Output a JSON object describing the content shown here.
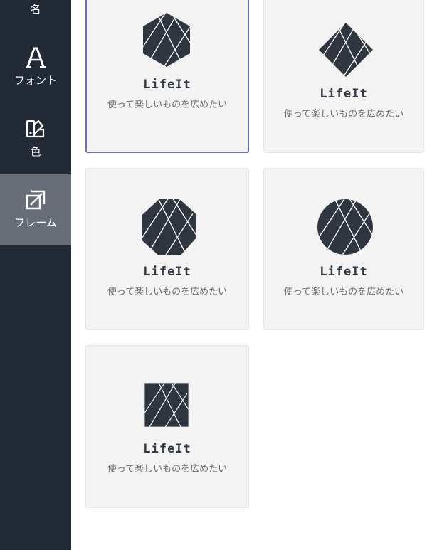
{
  "sidebar": {
    "items": [
      {
        "label": "名",
        "icon": "tag-icon"
      },
      {
        "label": "フォント",
        "icon": "font-icon"
      },
      {
        "label": "色",
        "icon": "paint-palette-icon"
      },
      {
        "label": "フレーム",
        "icon": "frame-edit-icon",
        "active": true
      }
    ]
  },
  "cards": [
    {
      "brand": "LifeIt",
      "tagline": "使って楽しいものを広めたい",
      "frame": "hexagon",
      "selected": true
    },
    {
      "brand": "LifeIt",
      "tagline": "使って楽しいものを広めたい",
      "frame": "diamond"
    },
    {
      "brand": "LifeIt",
      "tagline": "使って楽しいものを広めたい",
      "frame": "octagon"
    },
    {
      "brand": "LifeIt",
      "tagline": "使って楽しいものを広めたい",
      "frame": "circle"
    },
    {
      "brand": "LifeIt",
      "tagline": "使って楽しいものを広めたい",
      "frame": "square"
    }
  ],
  "colors": {
    "sidebar_bg": "#212a35",
    "sidebar_active_bg": "#666d76",
    "card_bg": "#f3f3f3",
    "selected_border": "#6b70b5",
    "logo_fill": "#2f3640",
    "logo_lines": "#ffffff"
  }
}
